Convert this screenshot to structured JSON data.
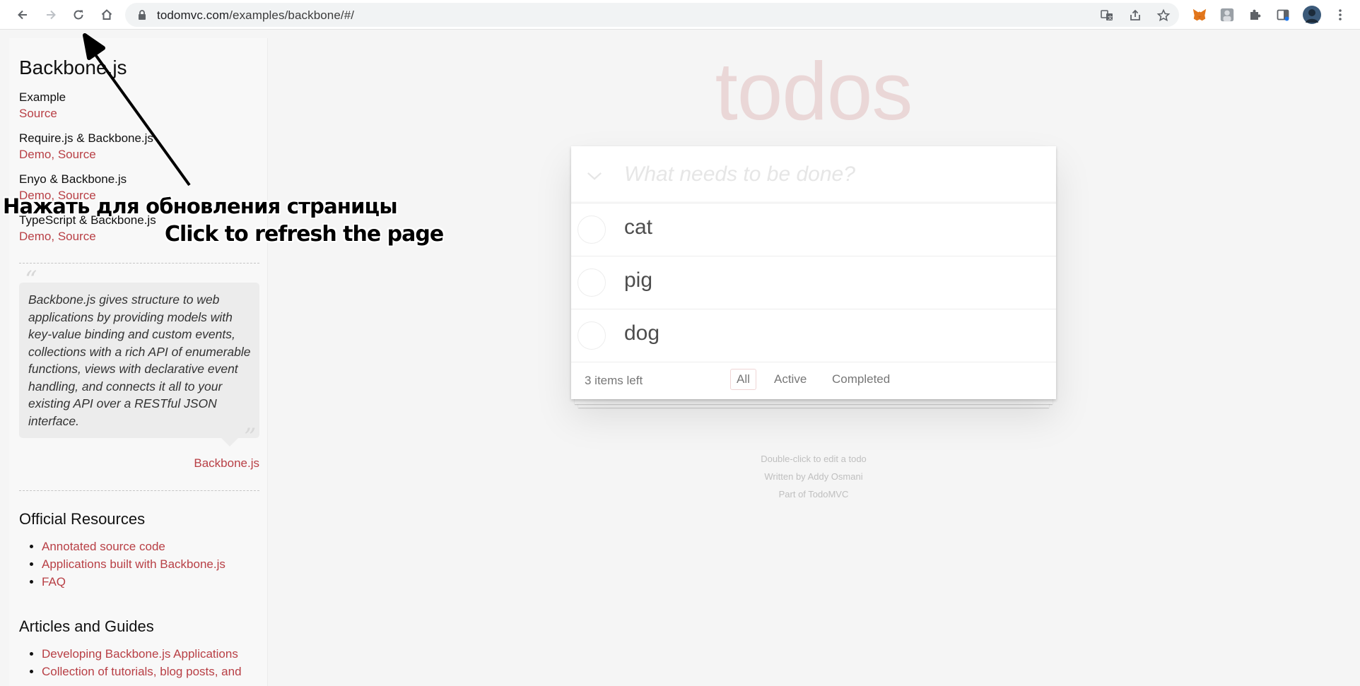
{
  "browser": {
    "url_host": "todomvc.com",
    "url_path": "/examples/backbone/#/"
  },
  "sidebar": {
    "title": "Backbone.js",
    "examples": [
      {
        "name": "Example",
        "links": [
          "Source"
        ]
      },
      {
        "name": "Require.js & Backbone.js",
        "links": [
          "Demo",
          "Source"
        ]
      },
      {
        "name": "Enyo & Backbone.js",
        "links": [
          "Demo",
          "Source"
        ]
      },
      {
        "name": "TypeScript & Backbone.js",
        "links": [
          "Demo",
          "Source"
        ]
      }
    ],
    "link_separator": ", ",
    "quote": "Backbone.js gives structure to web applications by providing models with key-value binding and custom events, collections with a rich API of enumerable functions, views with declarative event handling, and connects it all to your existing API over a RESTful JSON interface.",
    "quote_cite": "Backbone.js",
    "official_resources": {
      "heading": "Official Resources",
      "items": [
        "Annotated source code",
        "Applications built with Backbone.js",
        "FAQ"
      ]
    },
    "articles": {
      "heading": "Articles and Guides",
      "items": [
        "Developing Backbone.js Applications",
        "Collection of tutorials, blog posts, and"
      ]
    }
  },
  "app": {
    "title": "todos",
    "new_todo_placeholder": "What needs to be done?",
    "todos": [
      {
        "title": "cat",
        "completed": false
      },
      {
        "title": "pig",
        "completed": false
      },
      {
        "title": "dog",
        "completed": false
      }
    ],
    "count_text": "3 items left",
    "filters": [
      "All",
      "Active",
      "Completed"
    ],
    "selected_filter": "All"
  },
  "info": {
    "line1": "Double-click to edit a todo",
    "line2": "Written by Addy Osmani",
    "line3": "Part of TodoMVC"
  },
  "annotations": {
    "russian": "Нажать для обновления страницы",
    "english": "Click to refresh the page"
  },
  "colors": {
    "link": "#b83f45",
    "title": "rgba(175,47,47,0.15)",
    "background": "#f5f5f5"
  }
}
